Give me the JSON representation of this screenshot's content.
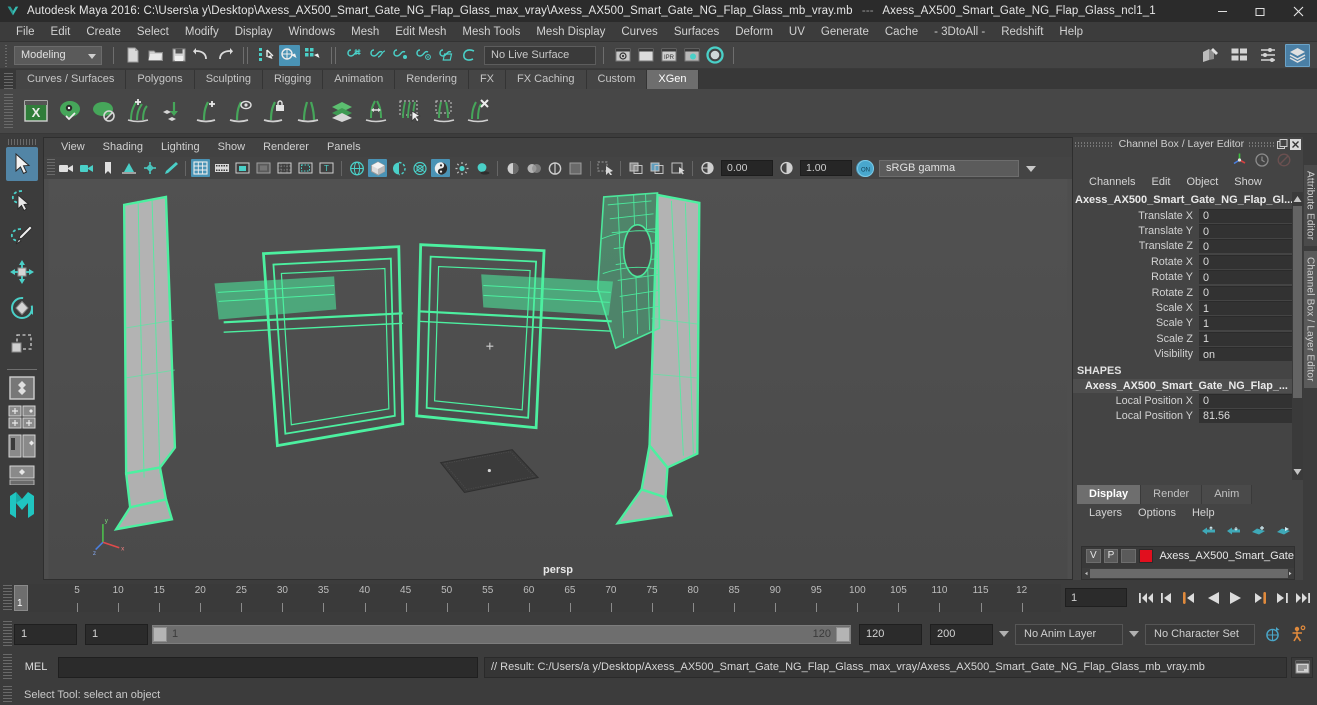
{
  "window": {
    "app_title": "Autodesk Maya 2016:",
    "file_path": "C:\\Users\\a y\\Desktop\\Axess_AX500_Smart_Gate_NG_Flap_Glass_max_vray\\Axess_AX500_Smart_Gate_NG_Flap_Glass_mb_vray.mb",
    "separator": "---",
    "selected_node": "Axess_AX500_Smart_Gate_NG_Flap_Glass_ncl1_1",
    "logo_icon": "maya-logo-icon",
    "controls": [
      {
        "name": "minimize-button",
        "icon": "minimize-icon"
      },
      {
        "name": "maximize-button",
        "icon": "restore-icon"
      },
      {
        "name": "close-button",
        "icon": "close-icon"
      }
    ]
  },
  "menubar": {
    "items": [
      "File",
      "Edit",
      "Create",
      "Select",
      "Modify",
      "Display",
      "Windows",
      "Mesh",
      "Edit Mesh",
      "Mesh Tools",
      "Mesh Display",
      "Curves",
      "Surfaces",
      "Deform",
      "UV",
      "Generate",
      "Cache",
      "- 3DtoAll -",
      "Redshift",
      "Help"
    ]
  },
  "statusline": {
    "menu_set": "Modeling",
    "live_surface": "No Live Surface",
    "icons": [
      {
        "name": "new-scene-icon",
        "glyph": "new-file"
      },
      {
        "name": "open-scene-icon",
        "glyph": "folder"
      },
      {
        "name": "save-scene-icon",
        "glyph": "floppy"
      },
      {
        "name": "undo-icon",
        "glyph": "undo"
      },
      {
        "name": "redo-icon",
        "glyph": "redo"
      },
      {
        "name": "select-by-hierarchy-icon",
        "glyph": "hierarchy"
      },
      {
        "name": "select-by-object-type-icon",
        "glyph": "object"
      },
      {
        "name": "select-by-component-type-icon",
        "glyph": "component"
      },
      {
        "name": "snap-to-grid-icon",
        "glyph": "grid-snap"
      },
      {
        "name": "snap-to-curve-icon",
        "glyph": "curve-snap"
      },
      {
        "name": "snap-to-point-icon",
        "glyph": "point-snap"
      },
      {
        "name": "snap-to-projected-center-icon",
        "glyph": "proj-center-snap"
      },
      {
        "name": "snap-to-view-planes-icon",
        "glyph": "view-plane-snap"
      },
      {
        "name": "make-live-icon",
        "glyph": "make-live"
      },
      {
        "name": "render-current-frame-icon",
        "glyph": "render"
      },
      {
        "name": "render-sequence-icon",
        "glyph": "render-seq"
      },
      {
        "name": "ipr-render-icon",
        "glyph": "ipr"
      },
      {
        "name": "render-settings-icon",
        "glyph": "render-settings"
      },
      {
        "name": "hypershade-icon",
        "glyph": "hypershade"
      }
    ],
    "right_icons": [
      {
        "name": "show-hide-modeling-toolkit-icon"
      },
      {
        "name": "show-hide-attribute-editor-icon"
      },
      {
        "name": "show-hide-tool-settings-icon"
      },
      {
        "name": "show-hide-channel-box-icon",
        "selected": true
      }
    ]
  },
  "shelf": {
    "tabs": [
      {
        "label": "Curves / Surfaces",
        "active": false
      },
      {
        "label": "Polygons",
        "active": false
      },
      {
        "label": "Sculpting",
        "active": false
      },
      {
        "label": "Rigging",
        "active": false
      },
      {
        "label": "Animation",
        "active": false
      },
      {
        "label": "Rendering",
        "active": false
      },
      {
        "label": "FX",
        "active": false
      },
      {
        "label": "FX Caching",
        "active": false
      },
      {
        "label": "Custom",
        "active": false
      },
      {
        "label": "XGen",
        "active": true
      }
    ],
    "buttons": [
      {
        "name": "xgen-editor-icon"
      },
      {
        "name": "xgen-preview-icon"
      },
      {
        "name": "xgen-disable-preview-icon"
      },
      {
        "name": "xgen-add-description-icon"
      },
      {
        "name": "xgen-import-collection-icon"
      },
      {
        "name": "xgen-add-guide-icon"
      },
      {
        "name": "xgen-show-guide-icon"
      },
      {
        "name": "xgen-lock-guide-icon"
      },
      {
        "name": "xgen-mirror-guide-icon"
      },
      {
        "name": "xgen-layers-icon"
      },
      {
        "name": "xgen-distribute-icon"
      },
      {
        "name": "xgen-select-patches-icon"
      },
      {
        "name": "xgen-region-icon"
      },
      {
        "name": "xgen-delete-icon"
      }
    ]
  },
  "toolbox": {
    "tools": [
      {
        "name": "select-tool",
        "selected": true
      },
      {
        "name": "lasso-select-tool",
        "selected": false
      },
      {
        "name": "paint-select-tool",
        "selected": false
      },
      {
        "name": "move-tool",
        "selected": false
      },
      {
        "name": "rotate-tool",
        "selected": false
      },
      {
        "name": "scale-tool",
        "selected": false
      }
    ],
    "layouts": [
      {
        "name": "single-perspective-layout"
      },
      {
        "name": "four-view-layout"
      },
      {
        "name": "outliner-persp-layout"
      },
      {
        "name": "persp-graph-layout"
      },
      {
        "name": "maya-bookmark-icon"
      }
    ]
  },
  "viewport": {
    "menus": [
      "View",
      "Shading",
      "Lighting",
      "Show",
      "Renderer",
      "Panels"
    ],
    "camera_label": "persp",
    "exposure": "0.00",
    "gamma_value": "1.00",
    "color_management": "sRGB gamma",
    "cm_toggle": "on",
    "axis": {
      "x": "x",
      "y": "y",
      "z": "z"
    },
    "toolbar_icons": [
      {
        "name": "select-camera-icon"
      },
      {
        "name": "camera-attributes-icon"
      },
      {
        "name": "bookmark-icon"
      },
      {
        "name": "image-plane-icon"
      },
      {
        "name": "two-d-pan-zoom-icon"
      },
      {
        "name": "grease-pencil-icon"
      },
      {
        "name": "grid-toggle-icon",
        "on": true
      },
      {
        "name": "film-gate-icon"
      },
      {
        "name": "resolution-gate-icon"
      },
      {
        "name": "gate-mask-icon"
      },
      {
        "name": "field-chart-icon"
      },
      {
        "name": "safe-action-icon"
      },
      {
        "name": "safe-title-icon"
      },
      {
        "name": "wireframe-icon"
      },
      {
        "name": "smooth-shade-all-icon",
        "on": true
      },
      {
        "name": "shaded-wireframe-icon"
      },
      {
        "name": "use-default-material-icon"
      },
      {
        "name": "shaded-textured-icon",
        "on": true
      },
      {
        "name": "use-all-lights-icon"
      },
      {
        "name": "shadows-icon"
      },
      {
        "name": "screen-space-ao-icon"
      },
      {
        "name": "motion-blur-icon"
      },
      {
        "name": "multisample-aa-icon"
      },
      {
        "name": "depth-of-field-icon"
      },
      {
        "name": "isolate-select-icon"
      },
      {
        "name": "xray-icon"
      },
      {
        "name": "xray-joints-icon"
      },
      {
        "name": "xray-active-components-icon"
      },
      {
        "name": "exposure-icon"
      },
      {
        "name": "gamma-icon"
      }
    ]
  },
  "channelbox": {
    "panel_title": "Channel Box / Layer Editor",
    "menus": [
      "Channels",
      "Edit",
      "Object",
      "Show"
    ],
    "object_name": "Axess_AX500_Smart_Gate_NG_Flap_Gl...",
    "transform_rows": [
      {
        "label": "Translate X",
        "value": "0"
      },
      {
        "label": "Translate Y",
        "value": "0"
      },
      {
        "label": "Translate Z",
        "value": "0"
      },
      {
        "label": "Rotate X",
        "value": "0"
      },
      {
        "label": "Rotate Y",
        "value": "0"
      },
      {
        "label": "Rotate Z",
        "value": "0"
      },
      {
        "label": "Scale X",
        "value": "1"
      },
      {
        "label": "Scale Y",
        "value": "1"
      },
      {
        "label": "Scale Z",
        "value": "1"
      },
      {
        "label": "Visibility",
        "value": "on"
      }
    ],
    "shapes_header": "SHAPES",
    "shape_name": "Axess_AX500_Smart_Gate_NG_Flap_...",
    "shape_rows": [
      {
        "label": "Local Position X",
        "value": "0"
      },
      {
        "label": "Local Position Y",
        "value": "81.56"
      }
    ],
    "header_icons": [
      {
        "name": "manipulator-axis-icon"
      },
      {
        "name": "timer-icon"
      },
      {
        "name": "no-entry-icon"
      }
    ],
    "dock_icons": [
      {
        "name": "undock-panel-icon"
      },
      {
        "name": "close-panel-icon"
      }
    ]
  },
  "layereditor": {
    "tabs": [
      {
        "label": "Display",
        "active": true
      },
      {
        "label": "Render",
        "active": false
      },
      {
        "label": "Anim",
        "active": false
      }
    ],
    "menus": [
      "Layers",
      "Options",
      "Help"
    ],
    "buttons": [
      {
        "name": "move-layer-up-icon"
      },
      {
        "name": "move-layer-down-icon"
      },
      {
        "name": "create-new-layer-icon"
      },
      {
        "name": "create-layer-from-selected-icon"
      }
    ],
    "layers": [
      {
        "visibility": "V",
        "playback": "P",
        "shading": "",
        "color": "#e10f1e",
        "name": "Axess_AX500_Smart_Gate"
      }
    ]
  },
  "edge_tabs": [
    {
      "label": "Attribute Editor",
      "selected": false
    },
    {
      "label": "Channel Box / Layer Editor",
      "selected": true
    }
  ],
  "timeslider": {
    "current_frame": "1",
    "tick_labels": [
      "5",
      "10",
      "15",
      "20",
      "25",
      "30",
      "35",
      "40",
      "45",
      "50",
      "55",
      "60",
      "65",
      "70",
      "75",
      "80",
      "85",
      "90",
      "95",
      "100",
      "105",
      "110",
      "115",
      "12"
    ],
    "playback_field": "1",
    "buttons": [
      {
        "name": "go-to-start-button",
        "icon": "skip-start-icon"
      },
      {
        "name": "step-back-keyframe-button",
        "icon": "prev-key-icon"
      },
      {
        "name": "step-back-frame-button",
        "icon": "prev-frame-icon"
      },
      {
        "name": "play-backwards-button",
        "icon": "play-back-icon"
      },
      {
        "name": "play-forwards-button",
        "icon": "play-forward-icon"
      },
      {
        "name": "step-forward-frame-button",
        "icon": "next-frame-icon"
      },
      {
        "name": "step-forward-keyframe-button",
        "icon": "next-key-icon"
      },
      {
        "name": "go-to-end-button",
        "icon": "skip-end-icon"
      }
    ]
  },
  "rangeslider": {
    "anim_start": "1",
    "playback_start": "1",
    "range_start_label": "1",
    "range_end_label": "120",
    "playback_end": "120",
    "anim_end": "200",
    "anim_layer": "No Anim Layer",
    "character_set": "No Character Set",
    "icons": [
      {
        "name": "auto-keyframe-toggle-icon"
      },
      {
        "name": "animation-preferences-icon"
      }
    ]
  },
  "commandline": {
    "language_label": "MEL",
    "input_value": "",
    "result_text": "// Result: C:/Users/a y/Desktop/Axess_AX500_Smart_Gate_NG_Flap_Glass_max_vray/Axess_AX500_Smart_Gate_NG_Flap_Glass_mb_vray.mb",
    "script_editor_icon": "script-editor-icon"
  },
  "helpline": {
    "text": "Select Tool: select an object"
  },
  "colors": {
    "accent_blue": "#5285a6",
    "wireframe_green": "#4cf0a0",
    "panel_bg": "#3c3c3c",
    "viewport_bg": "#4e4e4e",
    "layer_red": "#e10f1e"
  }
}
